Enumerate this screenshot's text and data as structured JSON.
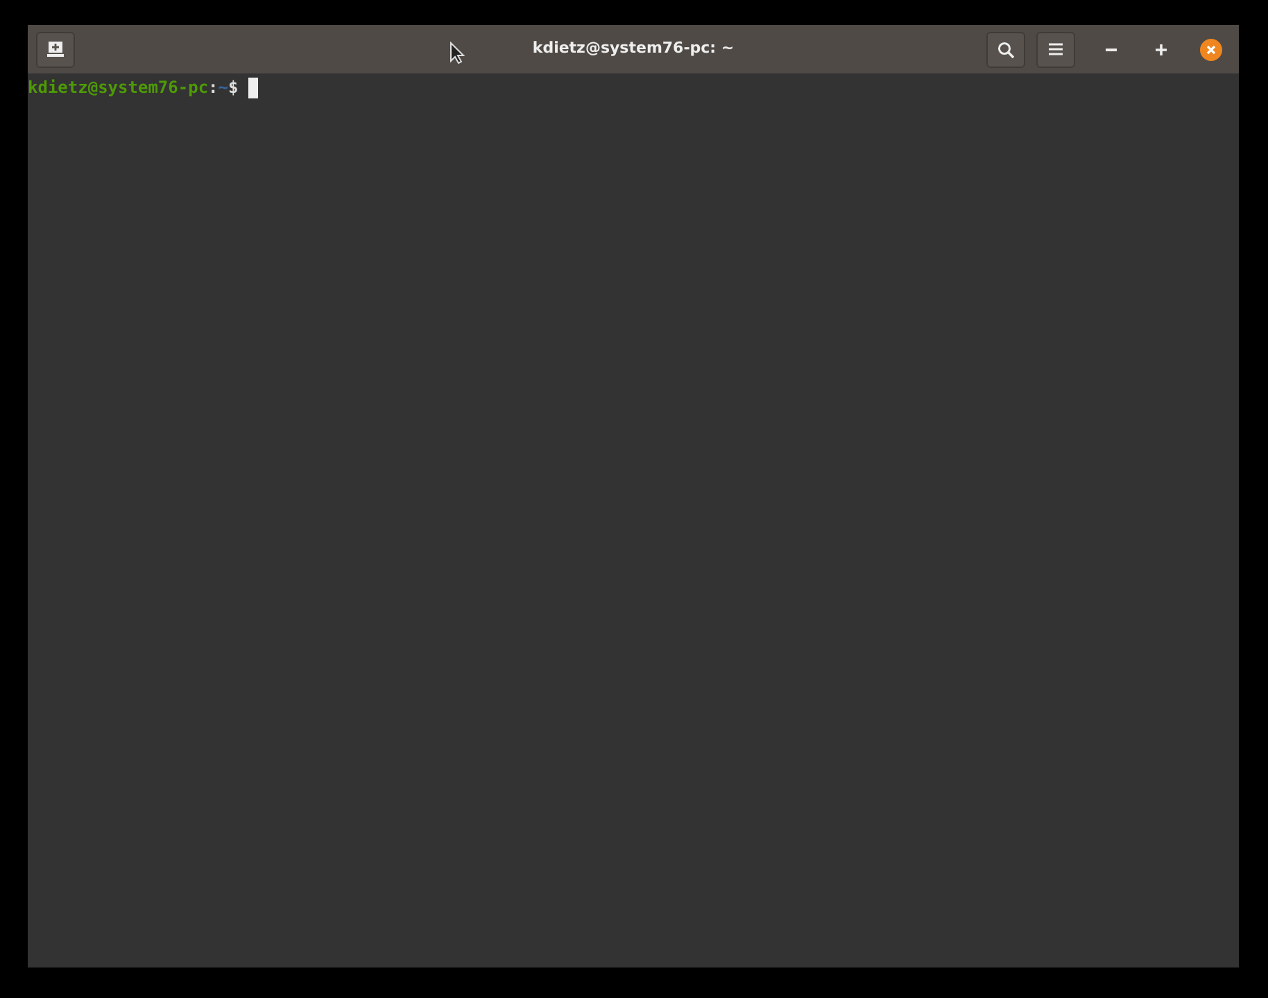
{
  "window": {
    "title": "kdietz@system76-pc: ~"
  },
  "prompt": {
    "user_host": "kdietz@system76-pc",
    "separator": ":",
    "path": "~",
    "symbol": "$"
  }
}
